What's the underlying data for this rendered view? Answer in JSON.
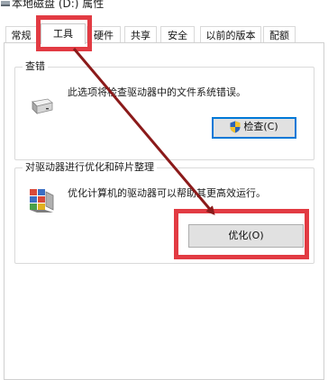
{
  "window": {
    "title": "本地磁盘 (D:) 属性"
  },
  "tabs": [
    {
      "label": "常规",
      "active": false
    },
    {
      "label": "工具",
      "active": true
    },
    {
      "label": "硬件",
      "active": false
    },
    {
      "label": "共享",
      "active": false
    },
    {
      "label": "安全",
      "active": false
    },
    {
      "label": "以前的版本",
      "active": false
    },
    {
      "label": "配额",
      "active": false
    }
  ],
  "error_check": {
    "group_title": "查错",
    "icon": "drive-icon",
    "description": "此选项将检查驱动器中的文件系统错误。",
    "button_icon": "shield-icon",
    "button_label": "检查(C)"
  },
  "optimize": {
    "group_title": "对驱动器进行优化和碎片整理",
    "icon": "defrag-icon",
    "description": "优化计算机的驱动器可以帮助其更高效运行。",
    "button_label": "优化(O)"
  },
  "annotations": {
    "highlight_color": "#e23b43",
    "arrow_color": "#8b1a1a",
    "focus_color": "#0078d7"
  }
}
